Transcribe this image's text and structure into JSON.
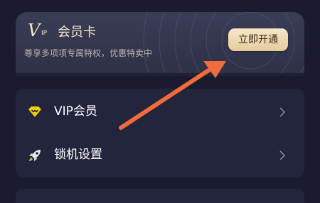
{
  "vip_card": {
    "logo_letter": "V",
    "logo_sub": "IP",
    "title": "会员卡",
    "subtitle": "尊享多项项专属特权，优惠特卖中",
    "open_button_label": "立即开通"
  },
  "menu": {
    "items": [
      {
        "label": "VIP会员",
        "icon": "vip-diamond-icon",
        "icon_color": "#f5d000"
      },
      {
        "label": "锁机设置",
        "icon": "rocket-icon",
        "icon_color": "#7ed957"
      }
    ]
  },
  "annotation": {
    "arrow_color": "#f26b3a"
  }
}
